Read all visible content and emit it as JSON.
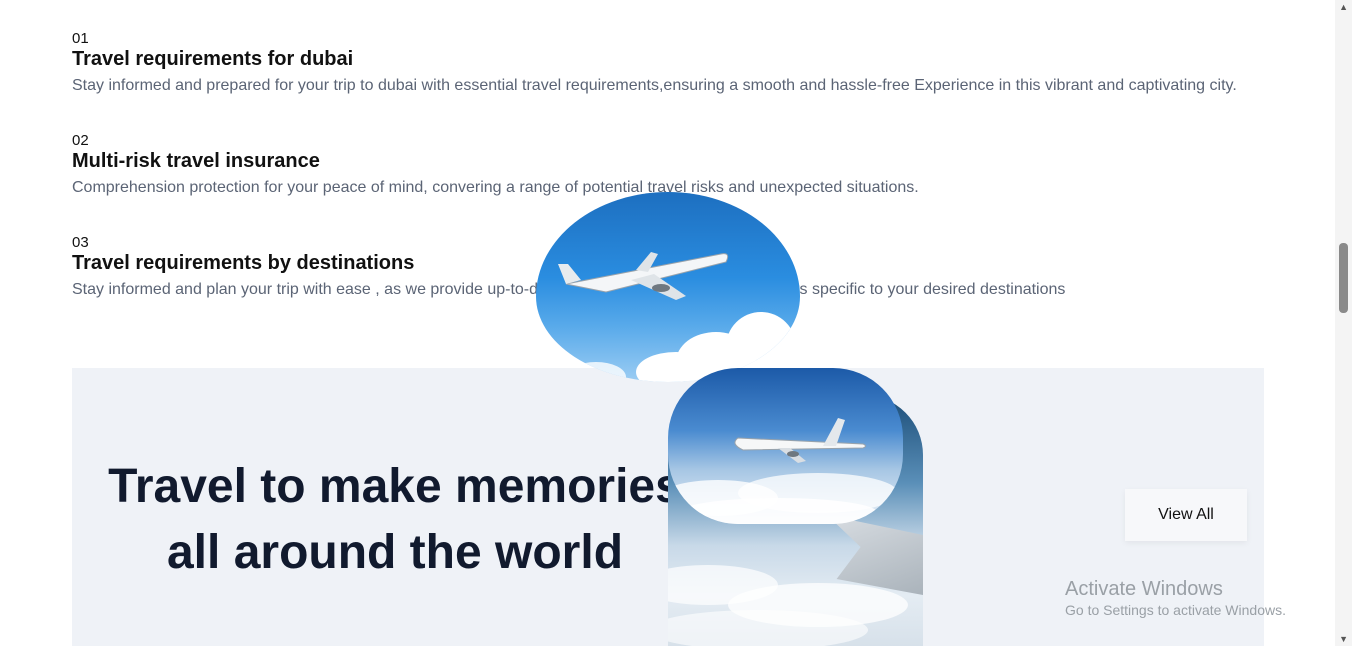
{
  "features": [
    {
      "num": "01",
      "title": "Travel requirements for dubai",
      "desc": "Stay informed and prepared for your trip to dubai with essential travel requirements,ensuring a smooth and hassle-free Experience in this vibrant and captivating city."
    },
    {
      "num": "02",
      "title": "Multi-risk travel insurance",
      "desc": "Comprehension protection for your peace of mind, convering a range of potential travel risks and unexpected situations."
    },
    {
      "num": "03",
      "title": "Travel requirements by destinations",
      "desc": "Stay informed and plan your trip with ease , as we provide up-to-date information on travel requirements specific to your desired destinations"
    }
  ],
  "banner": {
    "headline_line1": "Travel to make memories",
    "headline_line2": "all around the world",
    "view_all_label": "View All"
  },
  "watermark": {
    "title": "Activate Windows",
    "subtitle": "Go to Settings to activate Windows."
  },
  "icons": {
    "scroll_up": "scroll-up-arrow-icon",
    "scroll_down": "scroll-down-arrow-icon"
  }
}
